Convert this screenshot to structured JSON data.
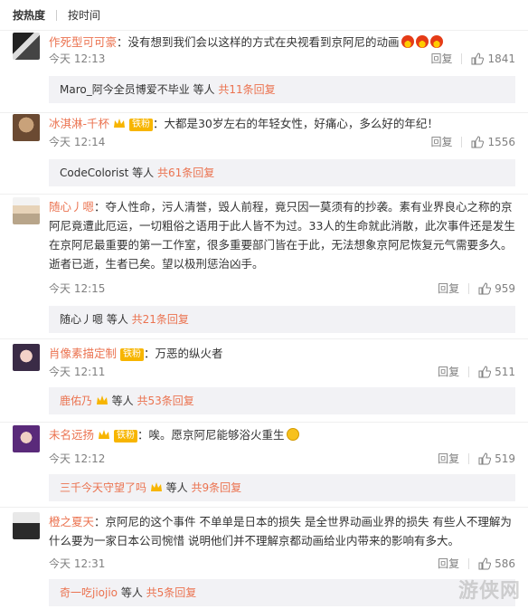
{
  "sort": {
    "hot": "按热度",
    "time": "按时间"
  },
  "comments": [
    {
      "user": "作死型可可豪",
      "text": "：没有想到我们会以这样的方式在央视看到京阿尼的动画",
      "emoji": [
        "fire-emoji",
        "fire-emoji",
        "fire-emoji"
      ],
      "time": "今天 12:13",
      "reply": "回复",
      "likes": "1841",
      "sub_user": "Maro_阿今全员博爱不毕业",
      "sub_etc": " 等人 ",
      "sub_total": "共11条回复"
    },
    {
      "user": "冰淇淋-千杯",
      "badge": "铁粉",
      "text": "：大都是30岁左右的年轻女性，好痛心，多么好的年纪！",
      "time": "今天 12:14",
      "reply": "回复",
      "likes": "1556",
      "sub_user": "CodeColorist",
      "sub_etc": " 等人 ",
      "sub_total": "共61条回复"
    },
    {
      "user": "随心丿嗯",
      "text": "：夺人性命，污人清誉，毁人前程，竟只因一莫须有的抄袭。素有业界良心之称的京阿尼竟遭此厄运，一切粗俗之语用于此人皆不为过。33人的生命就此消散，此次事件还是发生在京阿尼最重要的第一工作室，很多重要部门皆在于此，无法想象京阿尼恢复元气需要多久。逝者已逝，生者已矣。望以极刑惩治凶手。",
      "time": "今天 12:15",
      "reply": "回复",
      "likes": "959",
      "sub_user": "随心丿嗯",
      "sub_etc": " 等人 ",
      "sub_total": "共21条回复"
    },
    {
      "user": "肖像素描定制",
      "badge": "铁粉",
      "text": "：万恶的纵火者",
      "time": "今天 12:11",
      "reply": "回复",
      "likes": "511",
      "sub_user": "鹿佑乃",
      "sub_etc": " 等人 ",
      "sub_total": "共53条回复"
    },
    {
      "user": "未名远扬",
      "badge": "铁粉",
      "text": "：唉。愿京阿尼能够浴火重生",
      "time": "今天 12:12",
      "reply": "回复",
      "likes": "519",
      "sub_user": "三千今天守望了吗",
      "sub_etc": " 等人 ",
      "sub_total": "共9条回复"
    },
    {
      "user": "橙之夏天",
      "text": "：京阿尼的这个事件 不单单是日本的损失 是全世界动画业界的损失 有些人不理解为什么要为一家日本公司惋惜 说明他们并不理解京都动画给业内带来的影响有多大。",
      "time": "今天 12:31",
      "reply": "回复",
      "likes": "586",
      "sub_user": "奇一吃jiojio",
      "sub_etc": " 等人 ",
      "sub_total": "共5条回复"
    }
  ],
  "watermark": "游侠网",
  "colors": {
    "name": "#eb7350",
    "meta": "#808080",
    "subbox": "#f2f2f5",
    "badge": "#f7b500"
  }
}
